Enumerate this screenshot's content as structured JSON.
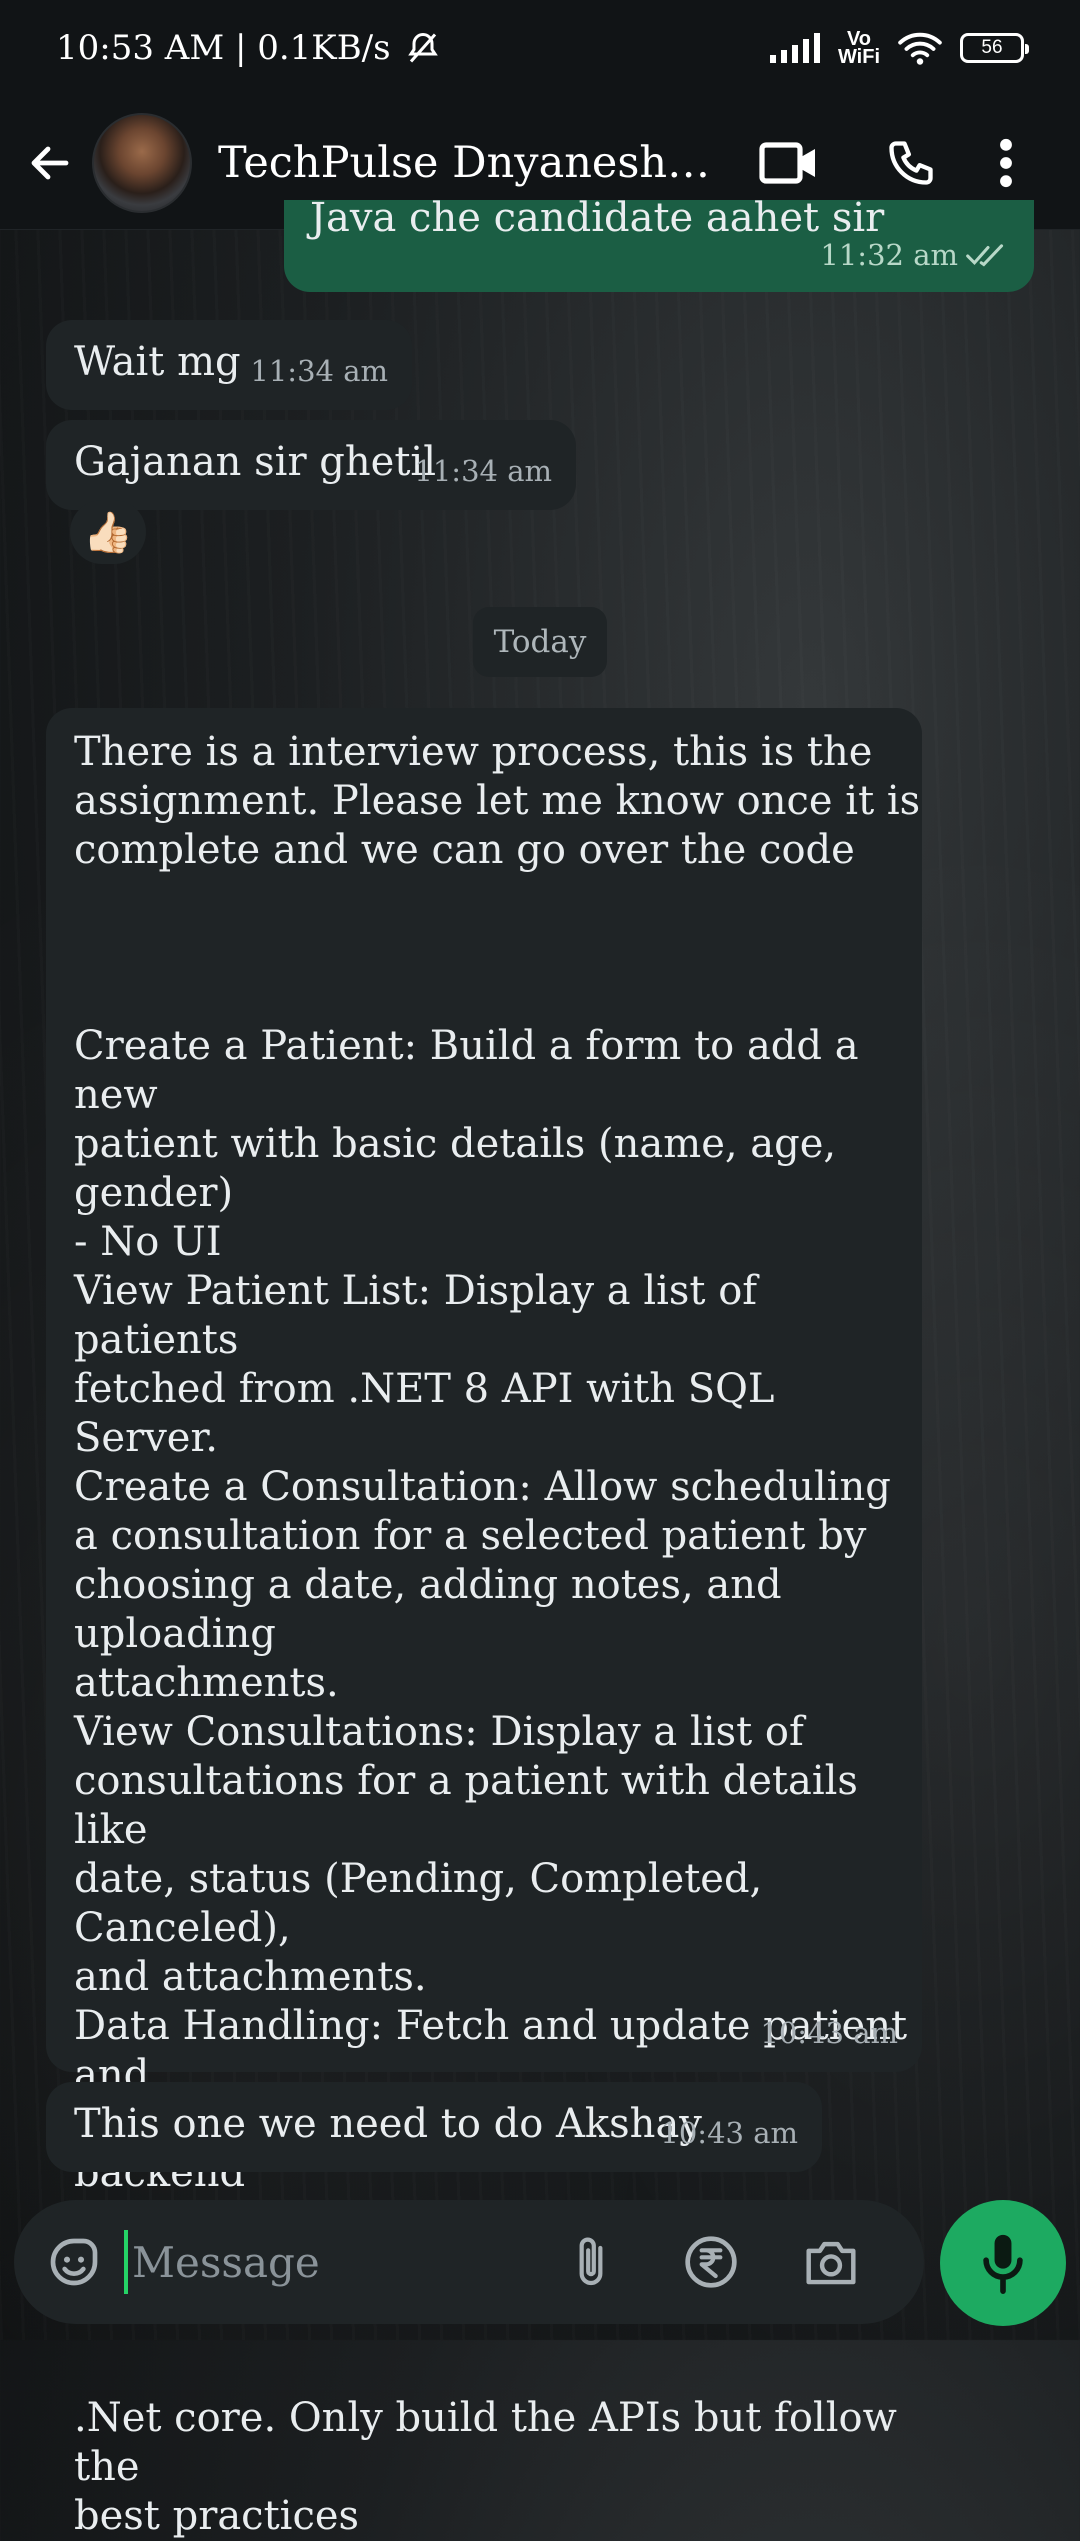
{
  "status": {
    "time_speed": "10:53 AM | 0.1KB/s",
    "vowifi": "Vo\nWiFi",
    "battery": "56"
  },
  "header": {
    "title": "TechPulse Dnyaneshwa..."
  },
  "messages": [
    {
      "dir": "out",
      "text": "Java che candidate aahet sir",
      "time": "11:32 am"
    },
    {
      "dir": "in",
      "text": "Wait mg",
      "time": "11:34 am"
    },
    {
      "dir": "in",
      "text": "Gajanan sir ghetil",
      "time": "11:34 am",
      "reaction": "👍🏻"
    },
    {
      "dir": "in",
      "text": "There is a interview process, this is the\nassignment. Please let me know once it is\ncomplete and we can go over the code\n\n\n\nCreate a Patient: Build a form to add a new\npatient with basic details (name, age, gender)\n- No UI\nView Patient List: Display a list of patients\nfetched from .NET 8 API with SQL Server.\nCreate a Consultation: Allow scheduling\na consultation for a selected patient by\nchoosing a date, adding notes, and uploading\nattachments.\nView Consultations: Display a list of\nconsultations for a patient with details like\ndate, status (Pending, Completed, Canceled),\nand attachments.\nData Handling: Fetch and update patient and\nconsultation data using .NET Core backend\nwith SQL Server.\n\n\n\n.Net core. Only build the APIs but follow the\nbest practices",
      "time": "10:43 am"
    },
    {
      "dir": "in",
      "text": "This one we need to do Akshay",
      "time": "10:43 am"
    }
  ],
  "date_divider": "Today",
  "input": {
    "placeholder": "Message"
  },
  "icons": {
    "back": "back-arrow-icon",
    "video": "video-call-icon",
    "call": "voice-call-icon",
    "menu": "more-vert-icon",
    "emoji": "emoji-sticker-icon",
    "attach": "paperclip-icon",
    "rupee": "rupee-payment-icon",
    "camera": "camera-icon",
    "mic": "microphone-icon"
  },
  "colors": {
    "accent": "#1daa61",
    "outgoing_bubble": "#1b5e44",
    "incoming_bubble": "#1f2426"
  }
}
